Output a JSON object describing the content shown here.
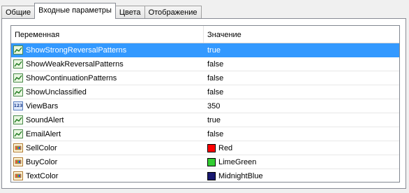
{
  "tabs": [
    "Общие",
    "Входные параметры",
    "Цвета",
    "Отображение"
  ],
  "active_tab": 1,
  "grid": {
    "col_variable": "Переменная",
    "col_value": "Значение",
    "rows": [
      {
        "name": "ShowStrongReversalPatterns",
        "value": "true",
        "icon": "chart-icon",
        "selected": true
      },
      {
        "name": "ShowWeakReversalPatterns",
        "value": "false",
        "icon": "chart-icon"
      },
      {
        "name": "ShowContinuationPatterns",
        "value": "false",
        "icon": "chart-icon"
      },
      {
        "name": "ShowUnclassified",
        "value": "false",
        "icon": "chart-icon"
      },
      {
        "name": "ViewBars",
        "value": "350",
        "icon": "number-icon",
        "icon_text": "123"
      },
      {
        "name": "SoundAlert",
        "value": "true",
        "icon": "chart-icon"
      },
      {
        "name": "EmailAlert",
        "value": "false",
        "icon": "chart-icon"
      },
      {
        "name": "SellColor",
        "value": "Red",
        "icon": "color-icon",
        "swatch": "#ff0000"
      },
      {
        "name": "BuyColor",
        "value": "LimeGreen",
        "icon": "color-icon",
        "swatch": "#32cd32"
      },
      {
        "name": "TextColor",
        "value": "MidnightBlue",
        "icon": "color-icon",
        "swatch": "#191970"
      }
    ]
  }
}
